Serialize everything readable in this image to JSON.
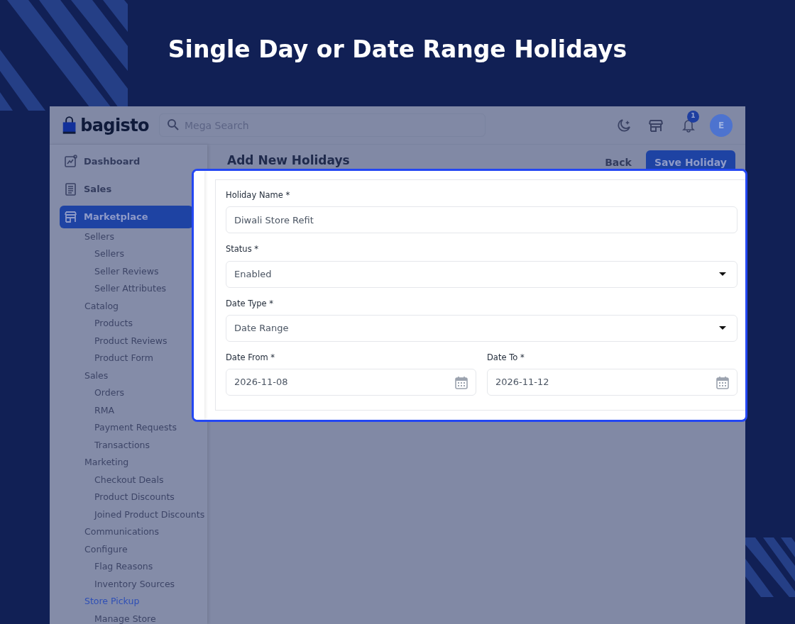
{
  "headline": "Single Day or Date Range Holidays",
  "header": {
    "logo": "bagisto",
    "search": {
      "placeholder": "Mega Search"
    },
    "notification_count": "1",
    "avatar": "E"
  },
  "sidebar": {
    "items": [
      {
        "label": "Dashboard",
        "selected": false
      },
      {
        "label": "Sales",
        "selected": false
      },
      {
        "label": "Marketplace",
        "selected": true,
        "children": [
          {
            "label": "Sellers",
            "selected": false,
            "children": [
              {
                "label": "Sellers",
                "selected": false
              },
              {
                "label": "Seller Reviews",
                "selected": false
              },
              {
                "label": "Seller Attributes",
                "selected": false
              }
            ]
          },
          {
            "label": "Catalog",
            "selected": false,
            "children": [
              {
                "label": "Products",
                "selected": false
              },
              {
                "label": "Product Reviews",
                "selected": false
              },
              {
                "label": "Product Form",
                "selected": false
              }
            ]
          },
          {
            "label": "Sales",
            "selected": false,
            "children": [
              {
                "label": "Orders",
                "selected": false
              },
              {
                "label": "RMA",
                "selected": false
              },
              {
                "label": "Payment Requests",
                "selected": false
              },
              {
                "label": "Transactions",
                "selected": false
              }
            ]
          },
          {
            "label": "Marketing",
            "selected": false,
            "children": [
              {
                "label": "Checkout Deals",
                "selected": false
              },
              {
                "label": "Product Discounts",
                "selected": false
              },
              {
                "label": "Joined Product Discounts",
                "selected": false
              }
            ]
          },
          {
            "label": "Communications",
            "selected": false
          },
          {
            "label": "Configure",
            "selected": false,
            "children": [
              {
                "label": "Flag Reasons",
                "selected": false
              },
              {
                "label": "Inventory Sources",
                "selected": false
              }
            ]
          },
          {
            "label": "Store Pickup",
            "selected": true,
            "children": [
              {
                "label": "Manage Store",
                "selected": false
              }
            ]
          }
        ]
      }
    ]
  },
  "page": {
    "title": "Add New Holidays",
    "buttons": [
      {
        "label": "Back",
        "kind": "link"
      },
      {
        "label": "Save Holiday",
        "kind": "primary"
      }
    ]
  },
  "form": {
    "rows": [
      [
        {
          "label": "Holiday Name *",
          "kind": "text",
          "value": "Diwali Store Refit"
        }
      ],
      [
        {
          "label": "Status *",
          "kind": "select",
          "value": "Enabled"
        }
      ],
      [
        {
          "label": "Date Type *",
          "kind": "select",
          "value": "Date Range"
        }
      ],
      [
        {
          "label": "Date From *",
          "kind": "date",
          "value": "2026-11-08"
        },
        {
          "label": "Date To *",
          "kind": "date",
          "value": "2026-11-12"
        }
      ]
    ]
  }
}
